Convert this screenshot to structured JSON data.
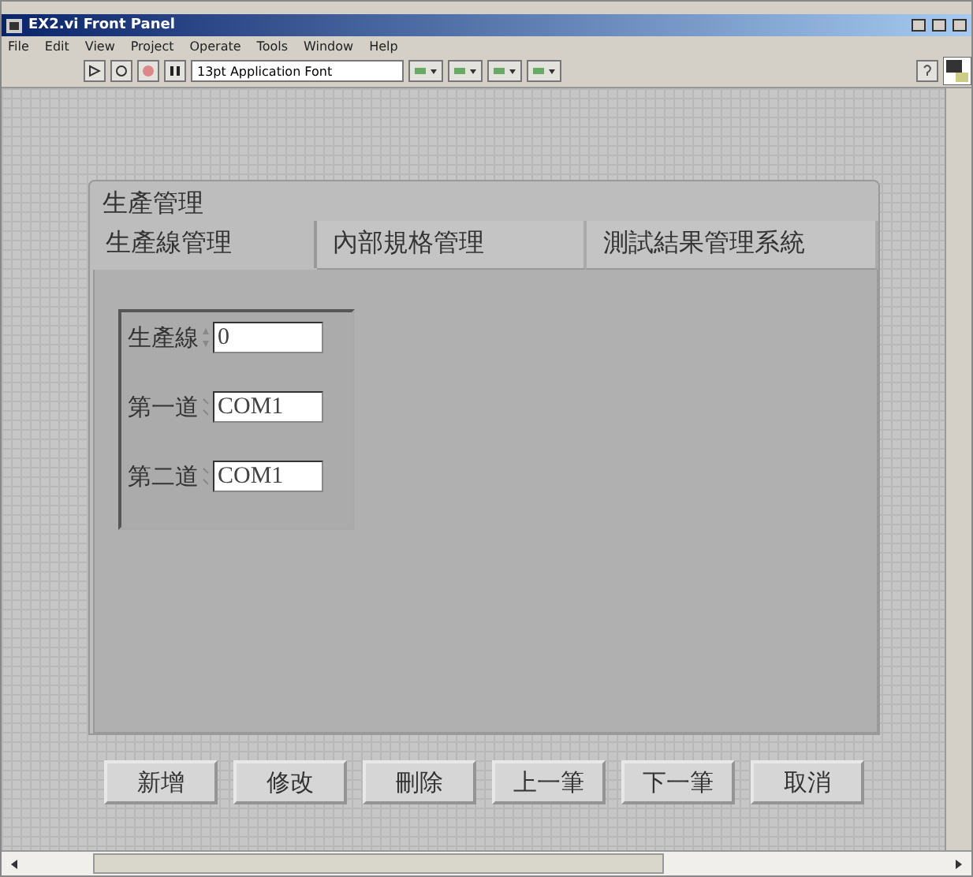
{
  "window": {
    "title": "EX2.vi Front Panel"
  },
  "menu": [
    "File",
    "Edit",
    "View",
    "Project",
    "Operate",
    "Tools",
    "Window",
    "Help"
  ],
  "toolbar": {
    "font": "13pt Application Font"
  },
  "tab_control": {
    "label": "生產管理",
    "tabs": [
      {
        "label": "生產線管理",
        "selected": true
      },
      {
        "label": "內部規格管理",
        "selected": false
      },
      {
        "label": "測試結果管理系統",
        "selected": false
      }
    ],
    "fields": [
      {
        "kind": "numeric",
        "label": "生產線",
        "value": "0"
      },
      {
        "kind": "string",
        "label": "第一道",
        "value": "COM1"
      },
      {
        "kind": "string",
        "label": "第二道",
        "value": "COM1"
      }
    ]
  },
  "buttons": [
    "新增",
    "修改",
    "刪除",
    "上一筆",
    "下一筆",
    "取消"
  ]
}
